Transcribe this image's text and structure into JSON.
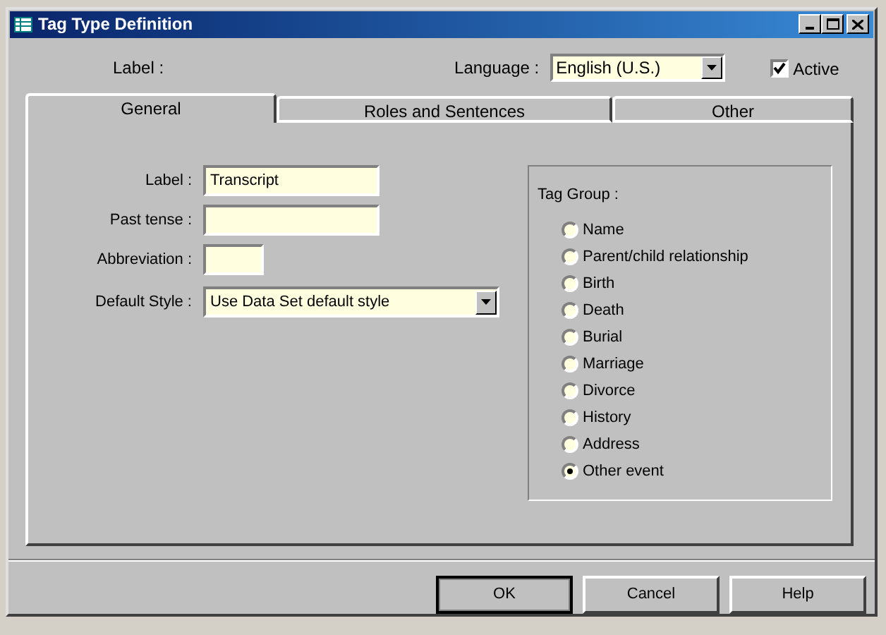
{
  "window": {
    "title": "Tag Type Definition"
  },
  "header": {
    "label": "Label :",
    "language_label": "Language :",
    "language": "English (U.S.)",
    "active": {
      "label": "Active",
      "checked": true
    }
  },
  "tabs": [
    {
      "label": "General",
      "selected": true
    },
    {
      "label": "Roles and Sentences",
      "selected": false
    },
    {
      "label": "Other",
      "selected": false
    }
  ],
  "fields": [
    {
      "label": "Label :",
      "value": "Transcript",
      "kind": "text"
    },
    {
      "label": "Past tense :",
      "kind": "text"
    },
    {
      "label": "Abbreviation :",
      "kind": "text"
    },
    {
      "label": "Default Style :",
      "value": "Use Data Set default style",
      "kind": "dropdown"
    }
  ],
  "tag_group": {
    "title": "Tag Group :",
    "options": [
      {
        "label": "Name",
        "selected": false
      },
      {
        "label": "Parent/child relationship",
        "selected": false
      },
      {
        "label": "Birth",
        "selected": false
      },
      {
        "label": "Death",
        "selected": false
      },
      {
        "label": "Burial",
        "selected": false
      },
      {
        "label": "Marriage",
        "selected": false
      },
      {
        "label": "Divorce",
        "selected": false
      },
      {
        "label": "History",
        "selected": false
      },
      {
        "label": "Address",
        "selected": false
      },
      {
        "label": "Other event",
        "selected": true
      }
    ]
  },
  "buttons": [
    "OK",
    "Cancel",
    "Help"
  ]
}
